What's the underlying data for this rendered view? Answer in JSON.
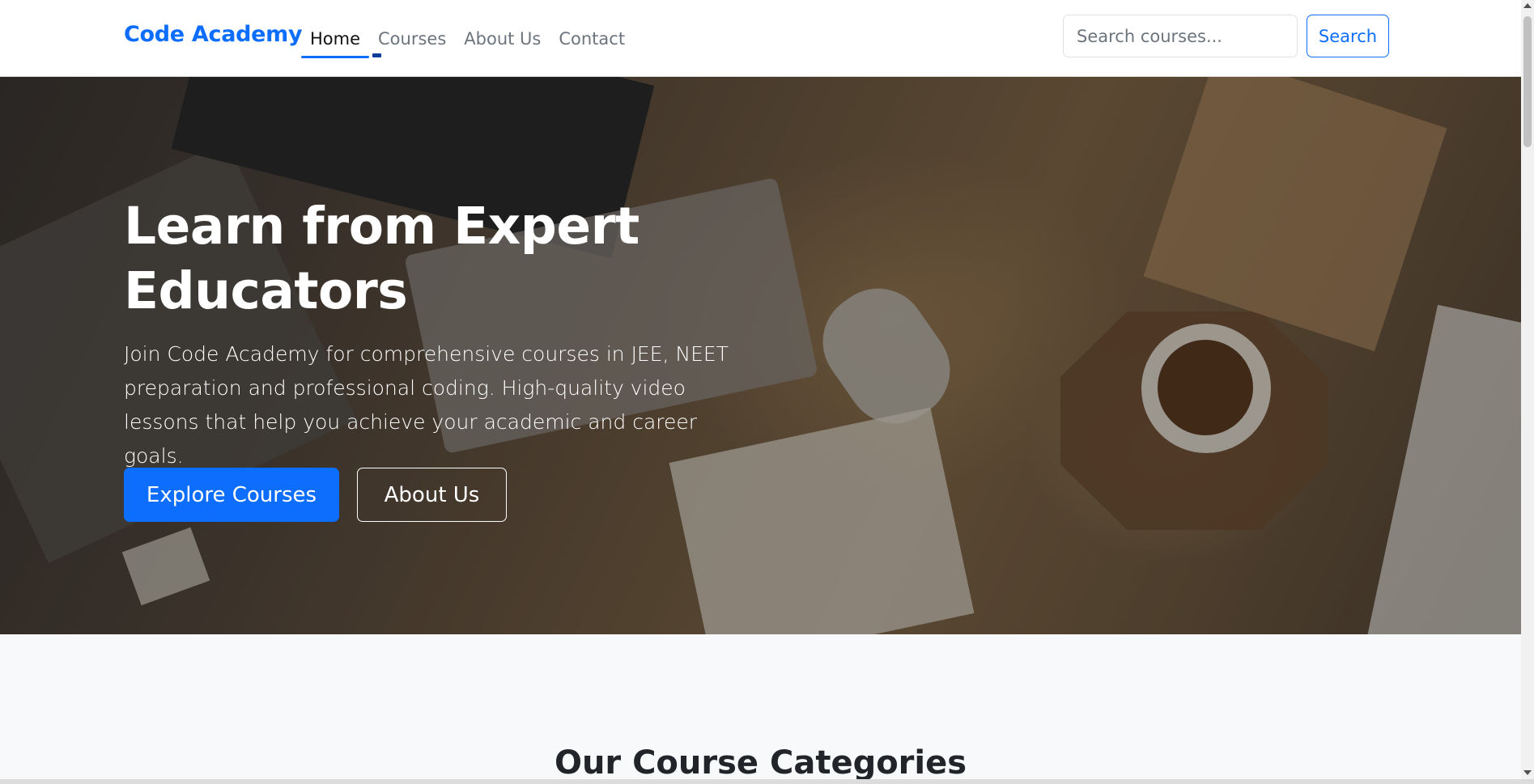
{
  "navbar": {
    "brand": "Code Academy",
    "items": [
      {
        "label": "Home",
        "active": true
      },
      {
        "label": "Courses",
        "active": false
      },
      {
        "label": "About Us",
        "active": false
      },
      {
        "label": "Contact",
        "active": false
      }
    ],
    "search": {
      "placeholder": "Search courses...",
      "value": "",
      "button_label": "Search"
    }
  },
  "hero": {
    "title": "Learn from Expert Educators",
    "description": "Join Code Academy for comprehensive courses in JEE, NEET preparation and professional coding. High-quality video lessons that help you achieve your academic and career goals.",
    "primary_button": "Explore Courses",
    "secondary_button": "About Us"
  },
  "categories": {
    "title": "Our Course Categories"
  },
  "colors": {
    "accent": "#0d6efd",
    "text_dark": "#212529",
    "muted": "#6c757d",
    "section_bg": "#f8f9fa"
  }
}
